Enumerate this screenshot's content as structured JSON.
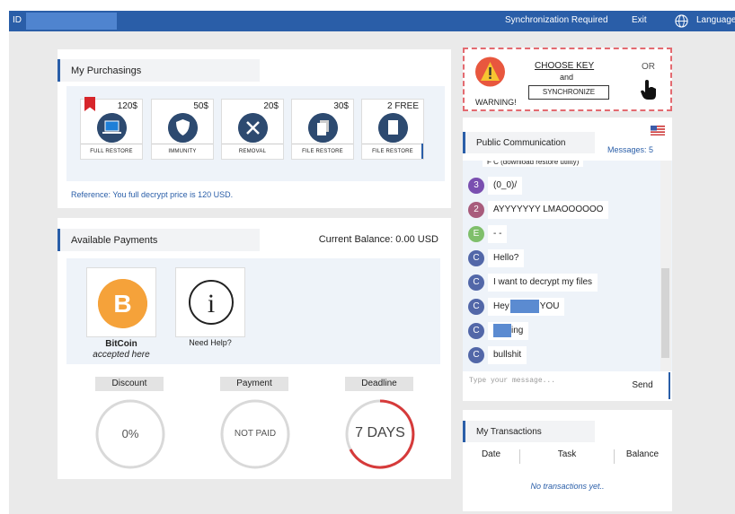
{
  "topbar": {
    "id_label": "ID",
    "sync_label": "Synchronization Required",
    "exit_label": "Exit",
    "language_label": "Language"
  },
  "purchasings": {
    "title": "My Purchasings",
    "items": [
      {
        "price": "120$",
        "label": "FULL RESTORE",
        "icon": "laptop-icon"
      },
      {
        "price": "50$",
        "label": "IMMUNITY",
        "icon": "shield-icon"
      },
      {
        "price": "20$",
        "label": "REMOVAL",
        "icon": "tools-icon"
      },
      {
        "price": "30$",
        "label": "FILE RESTORE",
        "icon": "files-icon"
      },
      {
        "price": "2 FREE",
        "label": "FILE RESTORE",
        "icon": "file-icon"
      }
    ],
    "reference": "Reference: You full decrypt price is 120 USD."
  },
  "payments": {
    "title": "Available Payments",
    "balance": "Current Balance: 0.00 USD",
    "bitcoin_name": "BitCoin",
    "bitcoin_sub": "accepted here",
    "help": "Need Help?",
    "discount": {
      "title": "Discount",
      "value": "0%"
    },
    "payment": {
      "title": "Payment",
      "value": "NOT PAID"
    },
    "deadline": {
      "title": "Deadline",
      "value": "7 DAYS"
    }
  },
  "warning": {
    "warning_label": "WARNING!",
    "choose_key": "CHOOSE  KEY",
    "and": "and",
    "synchronize": "SYNCHRONIZE",
    "or": "OR"
  },
  "communication": {
    "title": "Public Communication",
    "messages_count": "Messages: 5",
    "top_cut": "F C (download restore utility)",
    "messages": [
      {
        "avatar": "3",
        "text": "(0_0)/",
        "color": "#7a4fb0"
      },
      {
        "avatar": "2",
        "text": "AYYYYYYY LMAOOOOOO",
        "color": "#a85c7c"
      },
      {
        "avatar": "E",
        "text": "- -",
        "color": "#7fbf6b"
      },
      {
        "avatar": "C",
        "text": "Hello?",
        "color": "#5267a8"
      },
      {
        "avatar": "C",
        "text": "I want to decrypt my files",
        "color": "#5267a8"
      },
      {
        "avatar": "C",
        "text_pre": "Hey",
        "text_post": "YOU",
        "color": "#5267a8"
      },
      {
        "avatar": "C",
        "text_post": "ing",
        "color": "#5267a8"
      },
      {
        "avatar": "C",
        "text": "bullshit",
        "color": "#5267a8"
      }
    ],
    "placeholder": "Type your message...",
    "send_label": "Send"
  },
  "transactions": {
    "title": "My Transactions",
    "columns": [
      "Date",
      "Task",
      "Balance"
    ],
    "empty": "No transactions yet.."
  },
  "colors": {
    "brand": "#2a5ea8",
    "warning_red": "#e36a70",
    "bitcoin": "#f5a23a"
  }
}
